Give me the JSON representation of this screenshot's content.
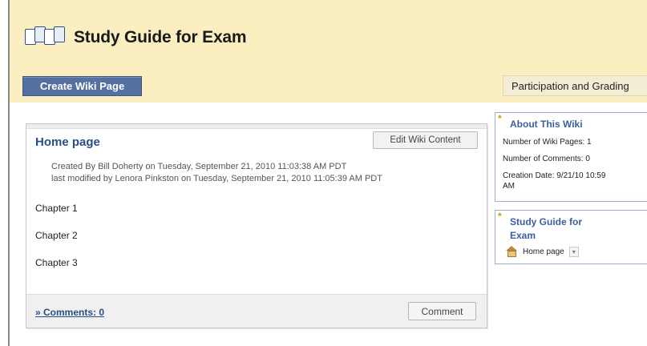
{
  "header": {
    "title": "Study Guide for Exam",
    "create_button_label": "Create Wiki Page",
    "participation_tab_label": "Participation and Grading"
  },
  "wiki_page": {
    "title": "Home page",
    "edit_button_label": "Edit Wiki Content",
    "created_line": "Created By Bill Doherty on Tuesday, September 21, 2010 11:03:38 AM PDT",
    "modified_line": "last modified by Lenora Pinkston on Tuesday, September 21, 2010 11:05:39 AM PDT",
    "chapters": [
      "Chapter 1",
      "Chapter 2",
      "Chapter 3"
    ],
    "comments_link_label": "» Comments: 0",
    "comment_button_label": "Comment"
  },
  "sidebar": {
    "about": {
      "title": "About This Wiki",
      "number_of_pages": "Number of Wiki Pages: 1",
      "number_of_comments": "Number of Comments: 0",
      "creation_date_line1": "Creation Date: 9/21/10 10:59",
      "creation_date_line2": "AM"
    },
    "guide": {
      "title_line1": "Study Guide for",
      "title_line2": "Exam",
      "nav_item_label": "Home page"
    }
  },
  "colors": {
    "header_band": "#fbeec0",
    "create_button": "#5470a0",
    "link_blue": "#2a4d86",
    "sidebar_border": "#9aaed4"
  },
  "icons": [
    "wiki-pages-icon",
    "home-icon",
    "chevron-down-icon",
    "corner-mark-icon"
  ]
}
